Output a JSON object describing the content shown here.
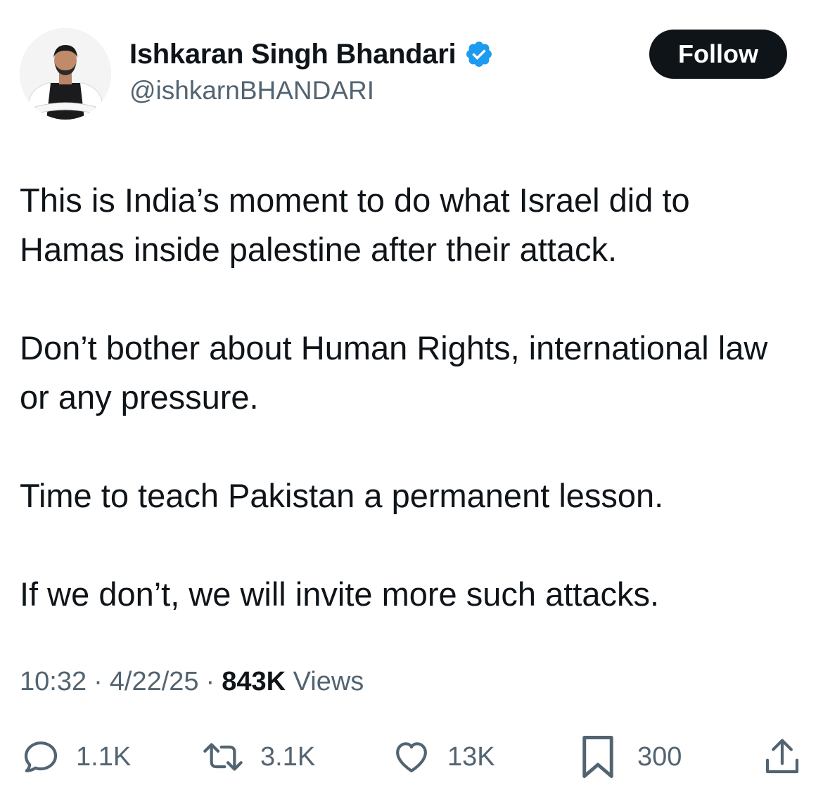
{
  "author": {
    "display_name": "Ishkaran Singh Bhandari",
    "handle": "@ishkarnBHANDARI",
    "verified_icon": "verified-badge-icon",
    "badge_color": "#1d9bf0"
  },
  "follow_button": {
    "label": "Follow"
  },
  "tweet": {
    "paragraphs": [
      "This is India’s moment to do what  Israel did to Hamas inside palestine after their attack.",
      "Don’t bother about Human Rights, international law or any pressure.",
      "Time to teach Pakistan a permanent lesson.",
      "If we don’t, we will invite more such attacks."
    ],
    "time": "10:32",
    "separator": "·",
    "date": "4/22/25",
    "views_count": "843K",
    "views_label": "Views"
  },
  "actions": {
    "replies": {
      "icon": "reply-icon",
      "count": "1.1K"
    },
    "reposts": {
      "icon": "repost-icon",
      "count": "3.1K"
    },
    "likes": {
      "icon": "heart-icon",
      "count": "13K"
    },
    "bookmarks": {
      "icon": "bookmark-icon",
      "count": "300"
    },
    "share": {
      "icon": "share-icon"
    }
  },
  "colors": {
    "text": "#0f1419",
    "secondary": "#536471",
    "button_bg": "#0f1419"
  }
}
